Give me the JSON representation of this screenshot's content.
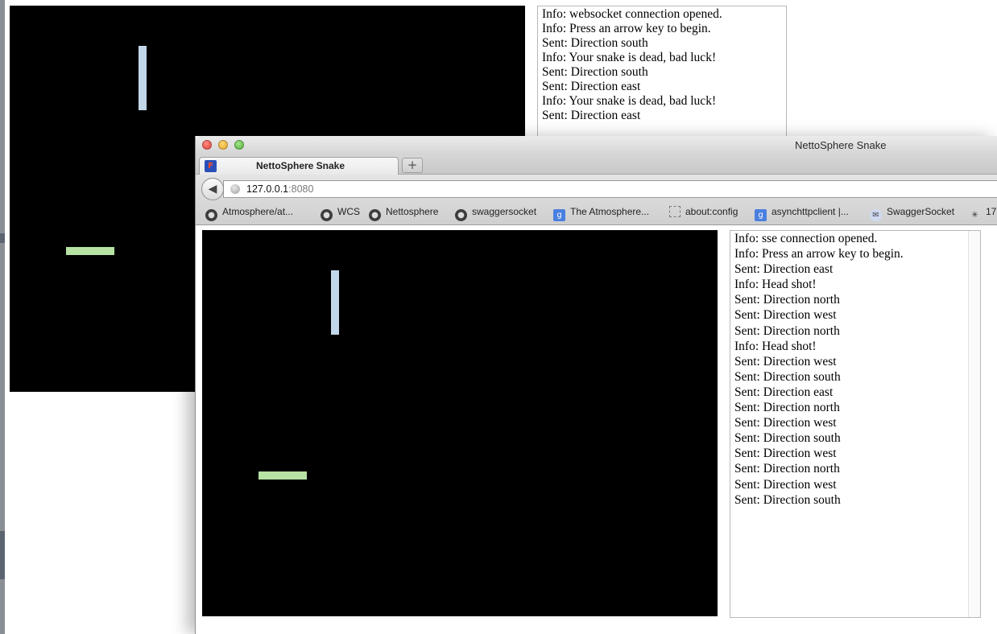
{
  "background_page": {
    "console_lines": [
      "Info: websocket connection opened.",
      "Info: Press an arrow key to begin.",
      "Sent: Direction south",
      "Info: Your snake is dead, bad luck!",
      "Sent: Direction south",
      "Sent: Direction east",
      "Info: Your snake is dead, bad luck!",
      "Sent: Direction east"
    ]
  },
  "window": {
    "title": "NettoSphere Snake",
    "tab": {
      "title": "NettoSphere Snake",
      "favicon_icon": "firefox-favicon"
    },
    "new_tab_label": "+",
    "back_icon": "back-arrow-icon",
    "url": {
      "host": "127.0.0.1",
      "port": ":8080"
    },
    "bookmarks": [
      {
        "label": "Atmosphere/at...",
        "icon": "github-icon"
      },
      {
        "label": "WCS",
        "icon": "github-icon"
      },
      {
        "label": "Nettosphere",
        "icon": "github-icon"
      },
      {
        "label": "swaggersocket",
        "icon": "github-icon"
      },
      {
        "label": "The Atmosphere...",
        "icon": "google-icon"
      },
      {
        "label": "about:config",
        "icon": "blank-page-icon"
      },
      {
        "label": "asynchttpclient |...",
        "icon": "google-icon"
      },
      {
        "label": "SwaggerSocket",
        "icon": "chat-bubble-icon"
      },
      {
        "label": "17",
        "icon": "loading-spinner-icon"
      }
    ]
  },
  "front_page": {
    "console_lines": [
      "Info: sse connection opened.",
      "Info: Press an arrow key to begin.",
      "Sent: Direction east",
      "Info: Head shot!",
      "Sent: Direction north",
      "Sent: Direction west",
      "Sent: Direction north",
      "Info: Head shot!",
      "Sent: Direction west",
      "Sent: Direction south",
      "Sent: Direction east",
      "Sent: Direction north",
      "Sent: Direction west",
      "Sent: Direction south",
      "Sent: Direction west",
      "Sent: Direction north",
      "Sent: Direction west",
      "Sent: Direction south"
    ]
  },
  "colors": {
    "snake_blue": "#c3d7ea",
    "snake_green": "#b6e2a4",
    "canvas_bg": "#000000"
  }
}
